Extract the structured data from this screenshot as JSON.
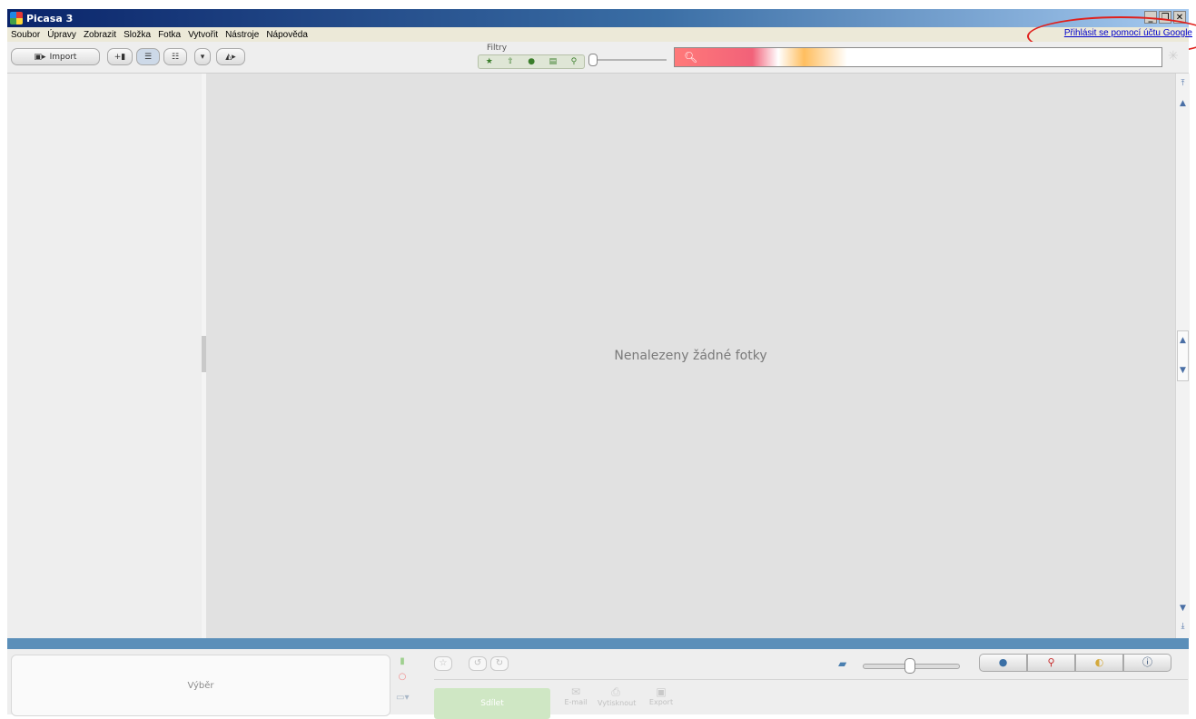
{
  "window": {
    "title": "Picasa 3",
    "controls": {
      "minimize": "_",
      "restore": "❐",
      "close": "✕"
    }
  },
  "menu": [
    "Soubor",
    "Úpravy",
    "Zobrazit",
    "Složka",
    "Fotka",
    "Vytvořit",
    "Nástroje",
    "Nápověda"
  ],
  "account": {
    "sign_in_link": "Přihlásit se pomocí účtu Google"
  },
  "toolbar": {
    "import_label": "Import",
    "filters_label": "Filtry",
    "search_placeholder": ""
  },
  "main": {
    "empty_message": "Nenalezeny žádné fotky"
  },
  "bottom": {
    "selection_label": "Výběr",
    "share_label": "Sdílet",
    "actions": [
      {
        "label": "E-mail",
        "icon": "email-icon"
      },
      {
        "label": "Vytisknout",
        "icon": "print-icon"
      },
      {
        "label": "Export",
        "icon": "export-icon"
      }
    ]
  },
  "colors": {
    "title_gradient_start": "#0a246a",
    "divider_blue": "#5b8fb9",
    "annotation_red": "#e0201c"
  }
}
